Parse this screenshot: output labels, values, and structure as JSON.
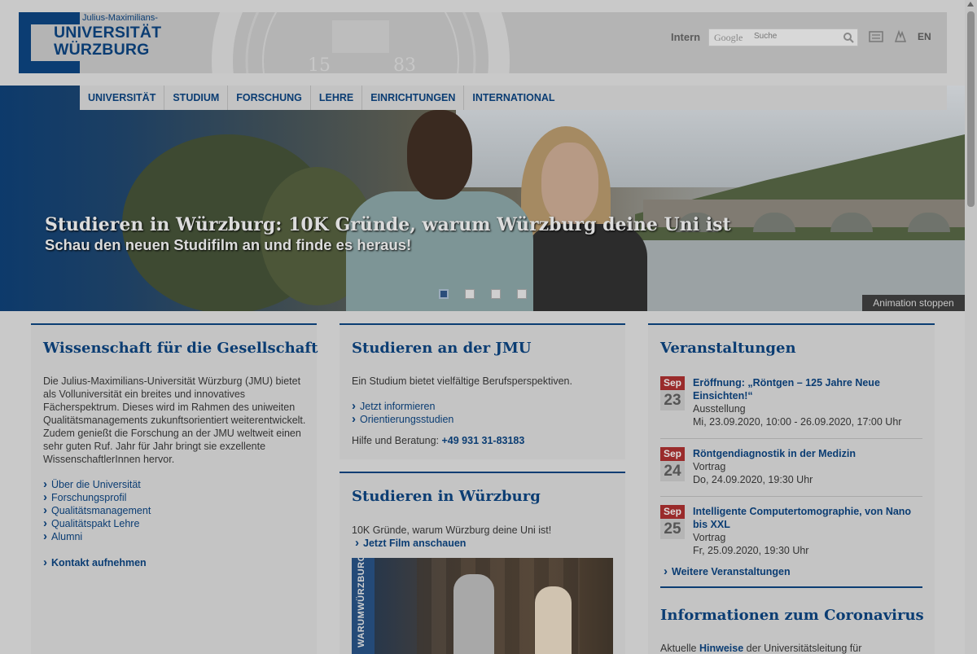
{
  "header": {
    "logo_small": "Julius-Maximilians-",
    "logo_line1": "UNIVERSITÄT",
    "logo_line2": "WÜRZBURG",
    "intern": "Intern",
    "search_brand": "Google",
    "search_placeholder": "Suche",
    "lang": "EN",
    "seal_numbers": [
      "15",
      "83"
    ]
  },
  "nav": {
    "items": [
      "UNIVERSITÄT",
      "STUDIUM",
      "FORSCHUNG",
      "LEHRE",
      "EINRICHTUNGEN",
      "INTERNATIONAL"
    ]
  },
  "hero": {
    "title": "Studieren in Würzburg: 10K Gründe, warum Würzburg deine Uni ist",
    "subtitle": "Schau den neuen Studifilm an und finde es heraus!",
    "stop_label": "Animation stoppen",
    "active_slide": 1,
    "slide_count": 4
  },
  "col1": {
    "title": "Wissenschaft für die Gesellschaft",
    "text": "Die Julius-Maximilians-Universität Würzburg (JMU) bietet als Volluniversität ein breites und innovatives Fächerspektrum. Dieses wird im Rahmen des uniweiten Qualitätsmanagements zukunftsorientiert weiterentwickelt. Zudem genießt die Forschung an der JMU weltweit einen sehr guten Ruf. Jahr für Jahr bringt sie exzellente WissenschaftlerInnen hervor.",
    "links": [
      "Über die Universität",
      "Forschungsprofil",
      "Qualitätsmanagement",
      "Qualitätspakt Lehre",
      "Alumni"
    ],
    "contact": "Kontakt aufnehmen"
  },
  "col2a": {
    "title": "Studieren an der JMU",
    "text": "Ein Studium bietet vielfältige Berufsperspektiven.",
    "links": [
      "Jetzt informieren",
      "Orientierungsstudien"
    ],
    "help_label": "Hilfe und Beratung:",
    "help_phone": "+49 931 31-83183"
  },
  "col2b": {
    "title": "Studieren in Würzburg",
    "text": "10K Gründe, warum Würzburg deine Uni ist!",
    "link": "Jetzt Film anschauen",
    "image_label": "WARUMWÜRZBURG"
  },
  "col3": {
    "title": "Veranstaltungen",
    "events": [
      {
        "month": "Sep",
        "day": "23",
        "title": "Eröffnung: „Röntgen – 125 Jahre Neue Einsichten!“",
        "type": "Ausstellung",
        "time": "Mi, 23.09.2020, 10:00 - 26.09.2020, 17:00 Uhr"
      },
      {
        "month": "Sep",
        "day": "24",
        "title": "Röntgendiagnostik in der Medizin",
        "type": "Vortrag",
        "time": "Do, 24.09.2020, 19:30 Uhr"
      },
      {
        "month": "Sep",
        "day": "25",
        "title": "Intelligente Computertomographie, von Nano bis XXL",
        "type": "Vortrag",
        "time": "Fr, 25.09.2020, 19:30 Uhr"
      }
    ],
    "more": "Weitere Veranstaltungen",
    "corona_title": "Informationen zum Coronavirus",
    "corona_text_pre": "Aktuelle",
    "corona_link": "Hinweise",
    "corona_text_post": "der Universitätsleitung für"
  },
  "colors": {
    "brand_blue": "#0b3d73",
    "event_month": "#9a2b2b",
    "overlay_bg": "#c9c9c9"
  }
}
